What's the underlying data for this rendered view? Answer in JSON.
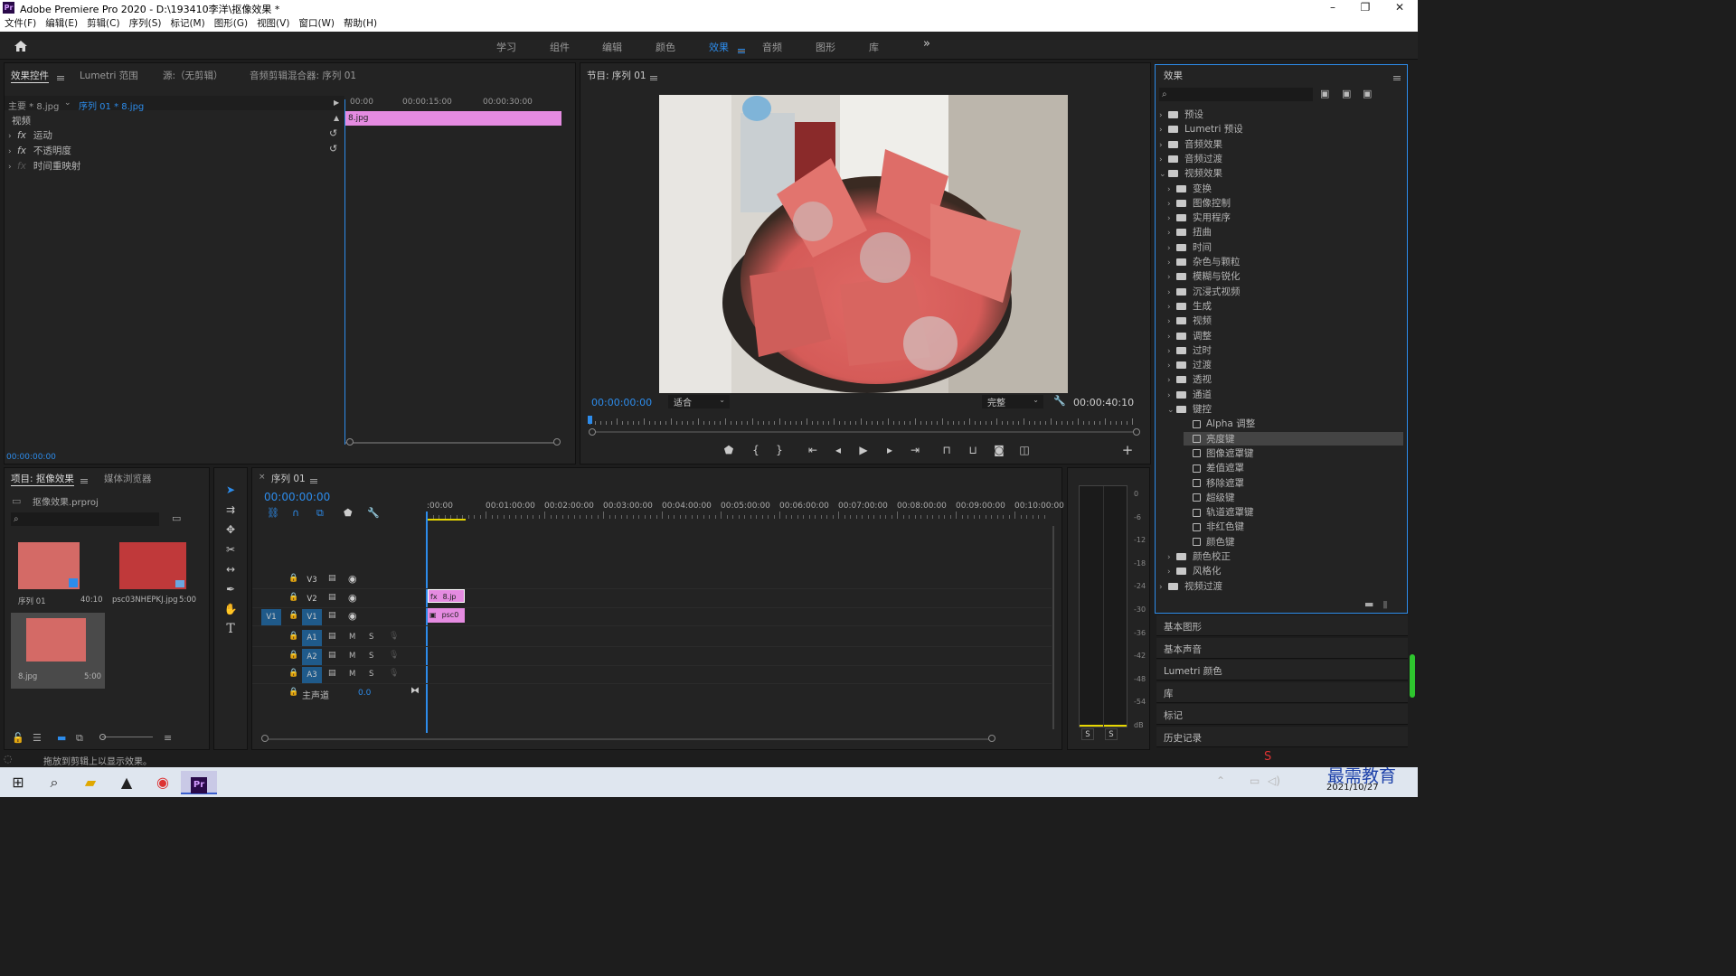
{
  "window": {
    "title": "Adobe Premiere Pro 2020 - D:\\193410李洋\\抠像效果 *"
  },
  "menu": [
    "文件(F)",
    "编辑(E)",
    "剪辑(C)",
    "序列(S)",
    "标记(M)",
    "图形(G)",
    "视图(V)",
    "窗口(W)",
    "帮助(H)"
  ],
  "workspaces": [
    "学习",
    "组件",
    "编辑",
    "颜色",
    "效果",
    "音频",
    "图形",
    "库"
  ],
  "active_workspace": "效果",
  "effect_controls": {
    "tabs": [
      "效果控件",
      "Lumetri 范围",
      "源:（无剪辑）",
      "音频剪辑混合器: 序列 01"
    ],
    "master": "主要 * 8.jpg",
    "sequence": "序列 01 * 8.jpg",
    "ruler": [
      "00:00",
      "00:00:15:00",
      "00:00:30:00"
    ],
    "clip": "8.jpg",
    "section": "视频",
    "rows": [
      "运动",
      "不透明度",
      "时间重映射"
    ],
    "timecode": "00:00:00:00"
  },
  "program": {
    "title": "节目: 序列 01",
    "timecode": "00:00:00:00",
    "fit": "适合",
    "quality": "完整",
    "duration": "00:00:40:10"
  },
  "effects_panel": {
    "title": "效果",
    "top": [
      "预设",
      "Lumetri 预设",
      "音频效果",
      "音频过渡",
      "视频效果"
    ],
    "video_effects": [
      "变换",
      "图像控制",
      "实用程序",
      "扭曲",
      "时间",
      "杂色与颗粒",
      "模糊与锐化",
      "沉浸式视频",
      "生成",
      "视频",
      "调整",
      "过时",
      "过渡",
      "透视",
      "通道",
      "键控"
    ],
    "keying": [
      "Alpha 调整",
      "亮度键",
      "图像遮罩键",
      "差值遮罩",
      "移除遮罩",
      "超级键",
      "轨道遮罩键",
      "非红色键",
      "颜色键"
    ],
    "after": [
      "颜色校正",
      "风格化"
    ],
    "bottom": [
      "视频过渡"
    ],
    "selected": "亮度键"
  },
  "side_panels": [
    "基本图形",
    "基本声音",
    "Lumetri 颜色",
    "库",
    "标记",
    "历史记录"
  ],
  "project": {
    "tabs": [
      "项目: 抠像效果",
      "媒体浏览器"
    ],
    "file": "抠像效果.prproj",
    "items": [
      {
        "name": "序列 01",
        "dur": "40:10"
      },
      {
        "name": "psc03NHEPKJ.jpg",
        "dur": "5:00"
      },
      {
        "name": "8.jpg",
        "dur": "5:00"
      }
    ]
  },
  "timeline": {
    "tab": "序列 01",
    "timecode": "00:00:00:00",
    "ruler": [
      ":00:00",
      "00:01:00:00",
      "00:02:00:00",
      "00:03:00:00",
      "00:04:00:00",
      "00:05:00:00",
      "00:06:00:00",
      "00:07:00:00",
      "00:08:00:00",
      "00:09:00:00",
      "00:10:00:00"
    ],
    "video_tracks": [
      "V3",
      "V2",
      "V1"
    ],
    "audio_tracks": [
      "A1",
      "A2",
      "A3"
    ],
    "master": "主声道",
    "master_val": "0.0",
    "clip_v2": "8.jp",
    "clip_v1": "psc0"
  },
  "meter": [
    "0",
    "-6",
    "-12",
    "-18",
    "-24",
    "-30",
    "-36",
    "-42",
    "-48",
    "-54",
    "dB"
  ],
  "status": "拖放到剪辑上以显示效果。",
  "taskbar": {
    "date": "2021/10/27",
    "brand": "最需教育"
  },
  "colors": {
    "accent": "#2d8ceb",
    "clip": "#e58be1"
  }
}
